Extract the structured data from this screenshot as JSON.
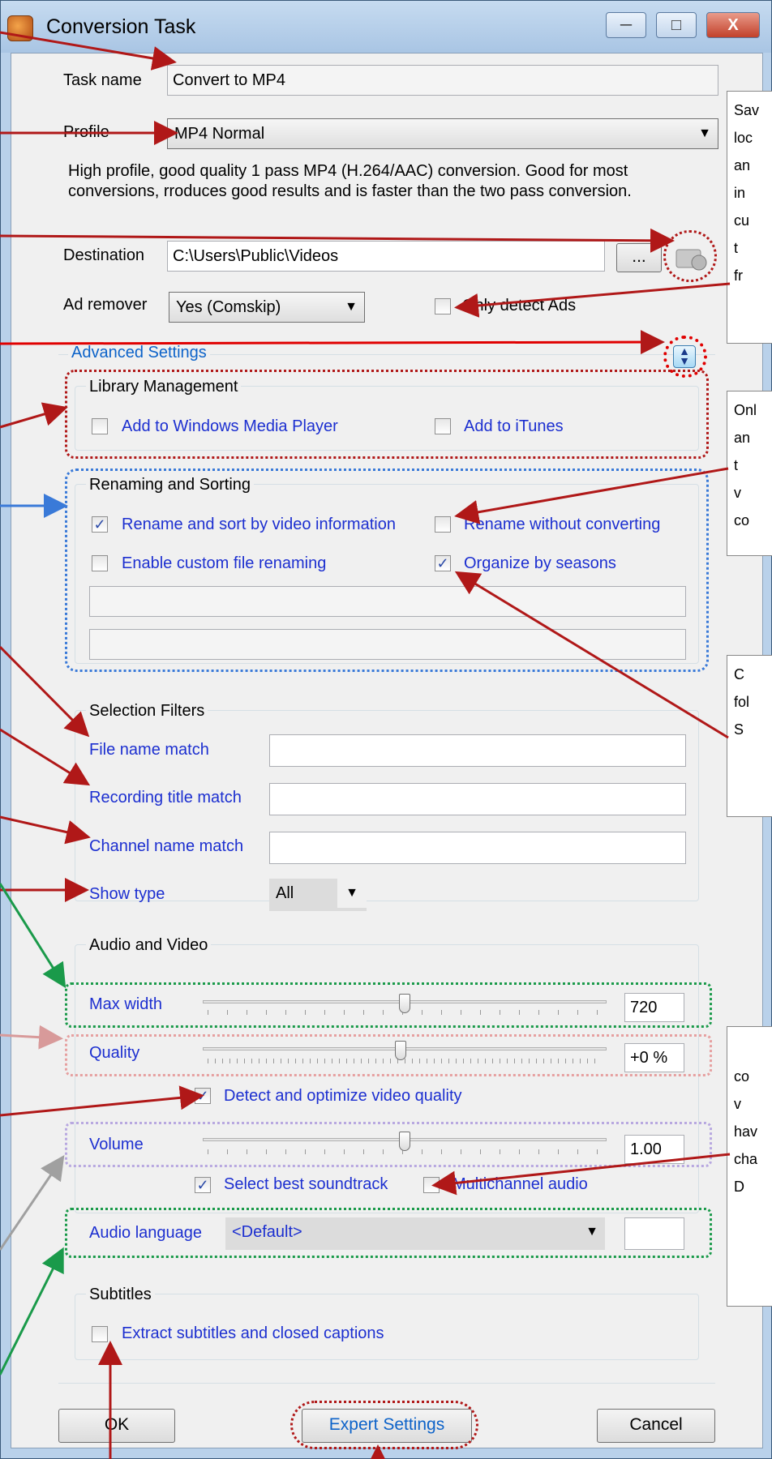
{
  "window": {
    "title": "Conversion Task",
    "minimize": "─",
    "maximize": "□",
    "close": "X"
  },
  "task_name": {
    "label": "Task name",
    "value": "Convert to MP4"
  },
  "profile": {
    "label": "Profile",
    "value": "MP4 Normal",
    "description_line1": "High profile, good quality 1 pass MP4 (H.264/AAC) conversion. Good for most",
    "description_line2": "conversions, rroduces good results and is faster than the two pass conversion."
  },
  "destination": {
    "label": "Destination",
    "value": "C:\\Users\\Public\\Videos",
    "browse_label": "..."
  },
  "ad_remover": {
    "label": "Ad remover",
    "value": "Yes (Comskip)",
    "only_detect_label": "Only detect Ads",
    "only_detect_checked": false
  },
  "advanced": {
    "label": "Advanced Settings"
  },
  "library": {
    "title": "Library Management",
    "wmp_label": "Add to Windows Media Player",
    "wmp_checked": false,
    "itunes_label": "Add to iTunes",
    "itunes_checked": false
  },
  "renaming": {
    "title": "Renaming and Sorting",
    "rename_sort_label": "Rename and sort by video information",
    "rename_sort_checked": true,
    "rename_no_convert_label": "Rename without converting",
    "rename_no_convert_checked": false,
    "custom_label": "Enable custom file renaming",
    "custom_checked": false,
    "seasons_label": "Organize by seasons",
    "seasons_checked": true,
    "field1": "",
    "field2": ""
  },
  "filters": {
    "title": "Selection Filters",
    "file_name_label": "File name match",
    "file_name_value": "",
    "recording_title_label": "Recording title match",
    "recording_title_value": "",
    "channel_label": "Channel name match",
    "channel_value": "",
    "show_type_label": "Show type",
    "show_type_value": "All"
  },
  "av": {
    "title": "Audio and Video",
    "max_width_label": "Max width",
    "max_width_value": "720",
    "max_width_level": 0.5,
    "quality_label": "Quality",
    "quality_value": "+0 %",
    "quality_level": 0.49,
    "detect_label": "Detect and optimize video quality",
    "detect_checked": true,
    "volume_label": "Volume",
    "volume_value": "1.00",
    "volume_level": 0.5,
    "soundtrack_label": "Select best soundtrack",
    "soundtrack_checked": true,
    "multichannel_label": "Multichannel audio",
    "multichannel_checked": false,
    "audio_language_label": "Audio language",
    "audio_language_value": "<Default>",
    "audio_language_code": ""
  },
  "subtitles": {
    "title": "Subtitles",
    "extract_label": "Extract subtitles and closed captions",
    "extract_checked": false
  },
  "buttons": {
    "ok": "OK",
    "expert": "Expert Settings",
    "cancel": "Cancel"
  },
  "callouts": {
    "c1": [
      "Sav",
      "loc",
      "an",
      "in",
      "cu",
      "t",
      "fr"
    ],
    "c2": [
      "Onl",
      "an",
      "t",
      "v",
      "co"
    ],
    "c3": [
      "C",
      "fol",
      "",
      "S"
    ],
    "c4": [
      "co",
      "v",
      "hav",
      "cha",
      "",
      "D"
    ]
  },
  "colors": {
    "annotation_red": "#b01818",
    "annotation_blue": "#3a7ad8",
    "annotation_green": "#1a9a4a"
  }
}
